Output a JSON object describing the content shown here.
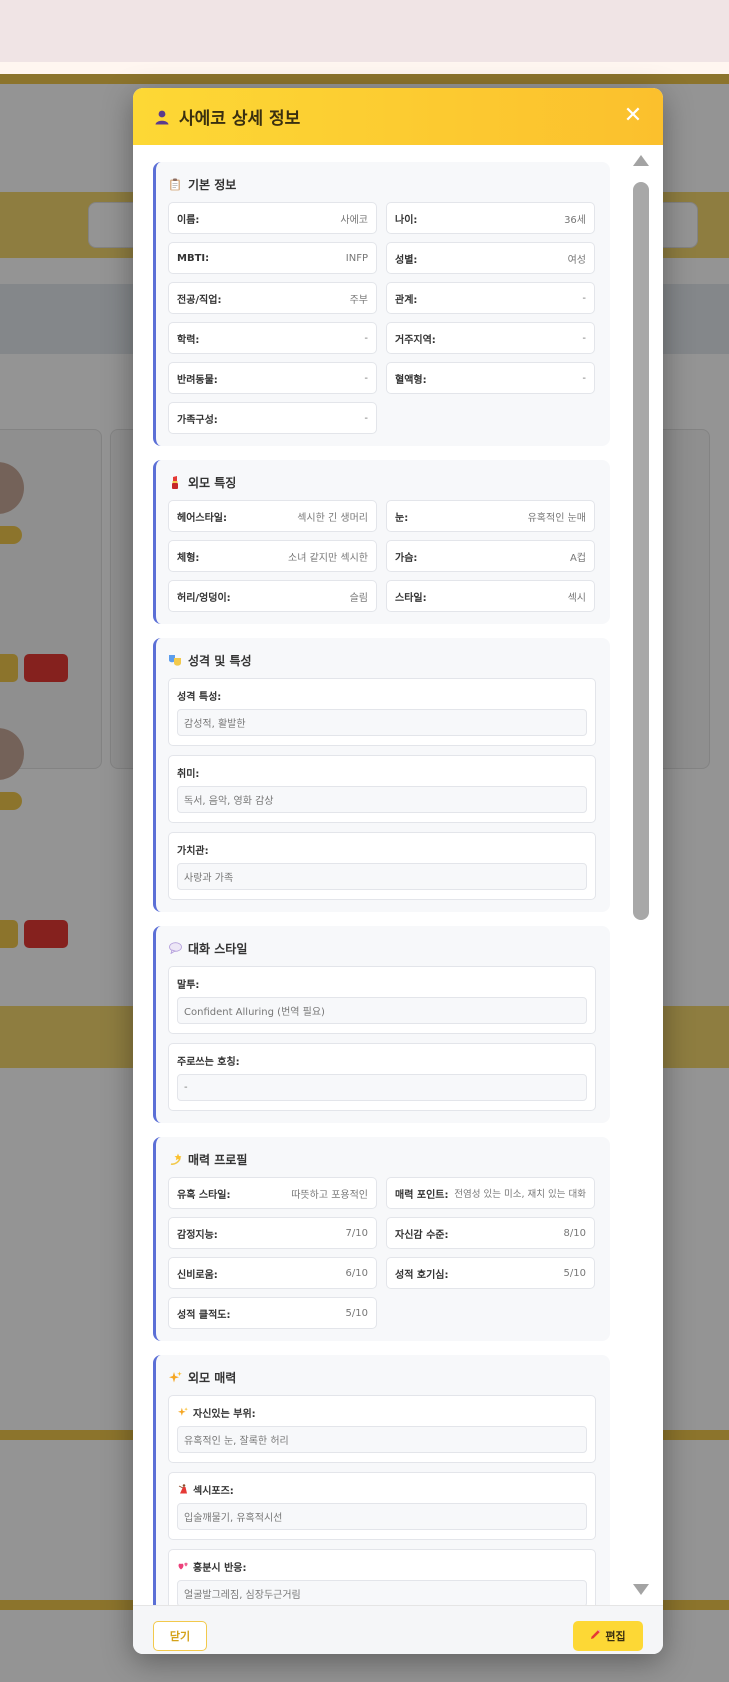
{
  "modal": {
    "title": "사에코 상세 정보",
    "close_symbol": "✕",
    "header_icon": "person-icon"
  },
  "basic": {
    "title": "기본 정보",
    "icon": "clipboard-icon",
    "fields": [
      {
        "label": "이름:",
        "value": "사에코"
      },
      {
        "label": "나이:",
        "value": "36세"
      },
      {
        "label": "MBTI:",
        "value": "INFP"
      },
      {
        "label": "성별:",
        "value": "여성"
      },
      {
        "label": "전공/직업:",
        "value": "주부"
      },
      {
        "label": "관계:",
        "value": "-"
      },
      {
        "label": "학력:",
        "value": "-"
      },
      {
        "label": "거주지역:",
        "value": "-"
      },
      {
        "label": "반려동물:",
        "value": "-"
      },
      {
        "label": "혈액형:",
        "value": "-"
      },
      {
        "label": "가족구성:",
        "value": "-"
      }
    ]
  },
  "appearance": {
    "title": "외모 특징",
    "icon": "lipstick-icon",
    "fields": [
      {
        "label": "헤어스타일:",
        "value": "섹시한 긴 생머리"
      },
      {
        "label": "눈:",
        "value": "유혹적인 눈매"
      },
      {
        "label": "체형:",
        "value": "소녀 같지만 섹시한"
      },
      {
        "label": "가슴:",
        "value": "A컵"
      },
      {
        "label": "허리/엉덩이:",
        "value": "슬림"
      },
      {
        "label": "스타일:",
        "value": "섹시"
      }
    ]
  },
  "personality": {
    "title": "성격 및 특성",
    "icon": "theater-masks-icon",
    "blocks": [
      {
        "label": "성격 특성:",
        "value": "감성적, 활발한"
      },
      {
        "label": "취미:",
        "value": "독서, 음악, 영화 감상"
      },
      {
        "label": "가치관:",
        "value": "사랑과 가족"
      }
    ]
  },
  "conversation": {
    "title": "대화 스타일",
    "icon": "speech-bubble-icon",
    "blocks": [
      {
        "label": "말투:",
        "value": "Confident Alluring (번역 필요)"
      },
      {
        "label": "주로쓰는 호칭:",
        "value": "-"
      }
    ]
  },
  "charm": {
    "title": "매력 프로필",
    "icon": "dizzy-star-icon",
    "fields": [
      {
        "label": "유혹 스타일:",
        "value": "따뜻하고 포용적인"
      },
      {
        "label": "매력 포인트:",
        "value": "전염성 있는 미소, 재치 있는 대화"
      },
      {
        "label": "감정지능:",
        "value": "7/10"
      },
      {
        "label": "자신감 수준:",
        "value": "8/10"
      },
      {
        "label": "신비로움:",
        "value": "6/10"
      },
      {
        "label": "성적 호기심:",
        "value": "5/10"
      },
      {
        "label": "성적 클적도:",
        "value": "5/10"
      }
    ]
  },
  "looks_charm": {
    "title": "외모 매력",
    "icon": "sparkles-icon",
    "blocks": [
      {
        "label": "자신있는 부위:",
        "value": "유혹적인 눈, 잘록한 허리",
        "icon": "sparkles-icon"
      },
      {
        "label": "섹시포즈:",
        "value": "입술깨물기, 유혹적시선",
        "icon": "dancer-icon"
      },
      {
        "label": "흥분시 반응:",
        "value": "얼굴발그레짐, 심장두근거림",
        "icon": "two-hearts-icon"
      }
    ]
  },
  "footer": {
    "close_label": "닫기",
    "edit_label": "편집",
    "edit_icon": "pencil-icon"
  }
}
